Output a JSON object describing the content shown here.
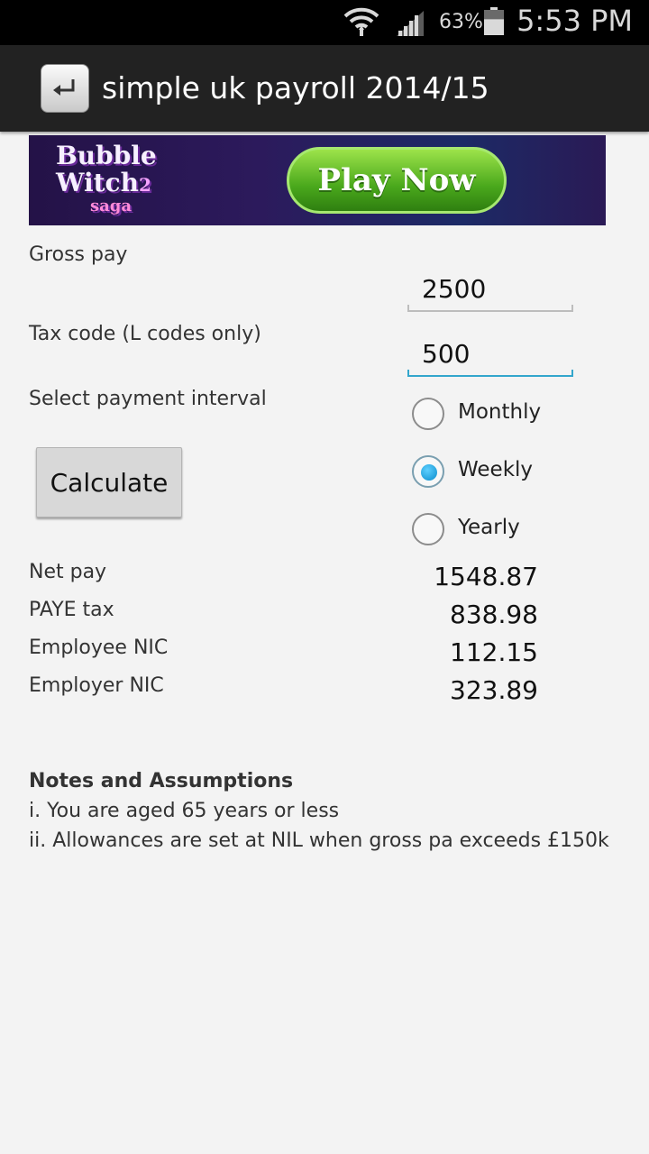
{
  "status_bar": {
    "time": "5:53 PM",
    "battery_percent": "63%",
    "battery_level": 0.63
  },
  "app_bar": {
    "title": "simple uk payroll 2014/15",
    "icon": "enter-key-icon"
  },
  "ad": {
    "logo_line1": "Bubble",
    "logo_line2": "Witch",
    "logo_sup": "2",
    "logo_sub": "saga",
    "button_label": "Play Now"
  },
  "form": {
    "gross_pay_label": "Gross pay",
    "gross_pay_value": "2500",
    "tax_code_label": "Tax code (L codes only)",
    "tax_code_value": "500",
    "interval_label": "Select payment interval",
    "intervals": [
      {
        "label": "Monthly",
        "checked": false
      },
      {
        "label": "Weekly",
        "checked": true
      },
      {
        "label": "Yearly",
        "checked": false
      }
    ],
    "calculate_label": "Calculate"
  },
  "results": [
    {
      "label": "Net pay",
      "value": "1548.87"
    },
    {
      "label": "PAYE tax",
      "value": "838.98"
    },
    {
      "label": "Employee NIC",
      "value": "112.15"
    },
    {
      "label": "Employer NIC",
      "value": "323.89"
    }
  ],
  "notes": {
    "title": "Notes and Assumptions",
    "lines": [
      "i. You are aged 65 years or less",
      "ii. Allowances are set at NIL when gross pa exceeds £150k"
    ]
  },
  "colors": {
    "accent": "#33a6cc",
    "radio_dot": "#0a8ccc",
    "background": "#f3f3f3",
    "action_bar": "#222222"
  }
}
